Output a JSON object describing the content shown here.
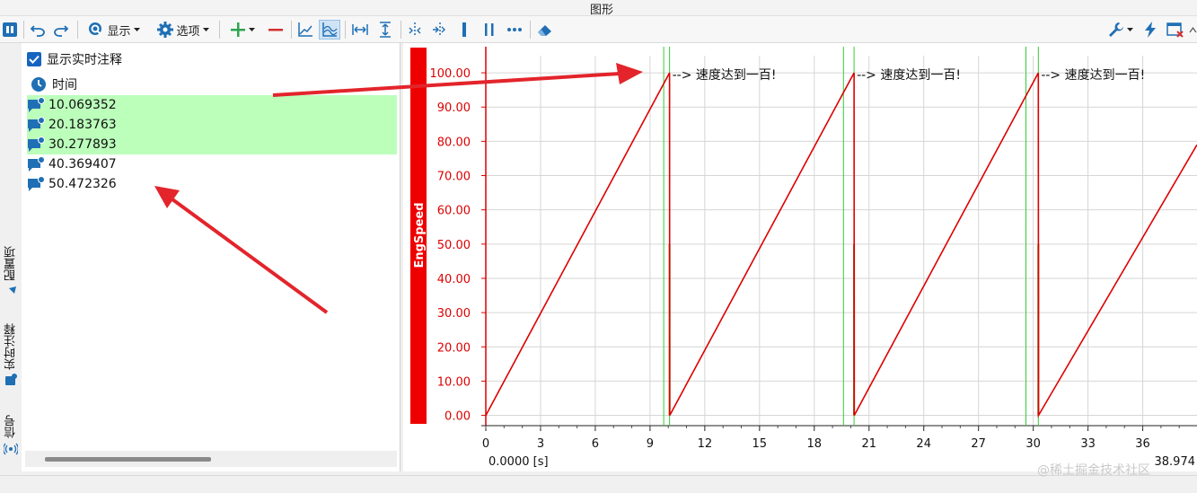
{
  "window": {
    "title": "图形"
  },
  "toolbar": {
    "display_label": "显示",
    "options_label": "选项"
  },
  "left_panel": {
    "show_realtime_annotation": "显示实时注释",
    "show_realtime_annotation_checked": true,
    "time_header": "时间",
    "annotations": [
      {
        "time": "10.069352",
        "highlighted": true
      },
      {
        "time": "20.183763",
        "highlighted": true
      },
      {
        "time": "30.277893",
        "highlighted": true
      },
      {
        "time": "40.369407",
        "highlighted": false
      },
      {
        "time": "50.472326",
        "highlighted": false
      }
    ]
  },
  "side_tabs": [
    {
      "label": "配置项"
    },
    {
      "label": "实时注释"
    },
    {
      "label": "信号"
    }
  ],
  "chart_data": {
    "type": "line",
    "ylabel": "EngSpeed",
    "series": [
      {
        "name": "EngSpeed",
        "color": "#dd0000",
        "x": [
          0,
          10.07,
          10.08,
          20.18,
          20.19,
          30.28,
          30.29,
          38.974
        ],
        "y": [
          0,
          100,
          0,
          100,
          0,
          100,
          0,
          79
        ]
      }
    ],
    "x_ticks": [
      "0",
      "3",
      "6",
      "9",
      "12",
      "15",
      "18",
      "21",
      "24",
      "27",
      "30",
      "33",
      "36"
    ],
    "x_tick_values": [
      0,
      3,
      6,
      9,
      12,
      15,
      18,
      21,
      24,
      27,
      30,
      33,
      36
    ],
    "y_ticks": [
      "0.00",
      "10.00",
      "20.00",
      "30.00",
      "40.00",
      "50.00",
      "60.00",
      "70.00",
      "80.00",
      "90.00",
      "100.00"
    ],
    "y_tick_values": [
      0,
      10,
      20,
      30,
      40,
      50,
      60,
      70,
      80,
      90,
      100
    ],
    "xlim": [
      0,
      38.974
    ],
    "ylim": [
      -3,
      105
    ],
    "x_start_label": "0.0000 [s]",
    "x_end_label": "38.974",
    "grid": true,
    "annotation_markers": [
      {
        "x": 10.07,
        "text": "--> 速度达到一百!"
      },
      {
        "x": 20.18,
        "text": "--> 速度达到一百!"
      },
      {
        "x": 30.28,
        "text": "--> 速度达到一百!"
      }
    ],
    "green_cursor_lines": [
      9.75,
      19.6,
      29.6
    ],
    "colors": {
      "axis": "#dd0000",
      "grid": "#d6d6d6",
      "ylabel_bar": "#ee0000",
      "marker": "#33cc33"
    }
  },
  "watermark": "@稀土掘金技术社区"
}
